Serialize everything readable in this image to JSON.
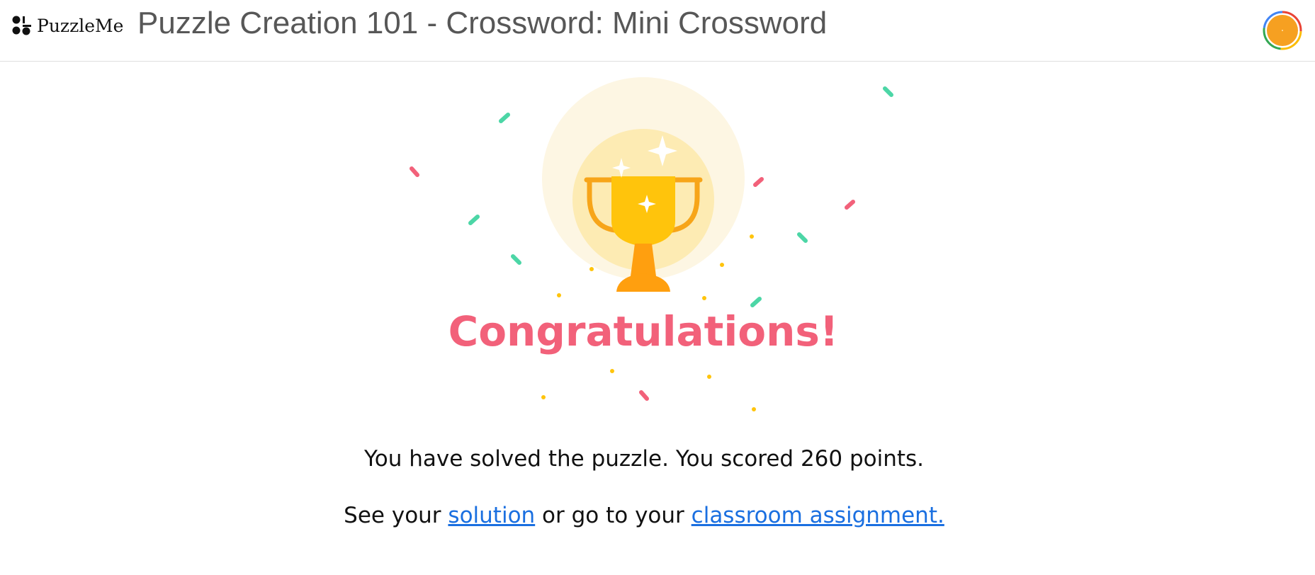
{
  "header": {
    "logo_text": "PuzzleMe",
    "title": "Puzzle Creation 101 - Crossword: Mini Crossword",
    "avatar_icon": "user-avatar-icon"
  },
  "celebration": {
    "heading": "Congratulations!",
    "trophy_icon": "trophy-icon",
    "confetti_icon": "confetti-icon",
    "heading_color": "#f2617a",
    "trophy_color": "#ffc40c"
  },
  "result": {
    "message": "You have solved the puzzle. You scored 260 points.",
    "links_prefix": "See your",
    "solution_link": "solution",
    "links_middle": "or go to your",
    "assignment_link": "classroom assignment."
  },
  "colors": {
    "link": "#1a6fe0",
    "title_text": "#575757",
    "avatar": "#f6a021"
  }
}
